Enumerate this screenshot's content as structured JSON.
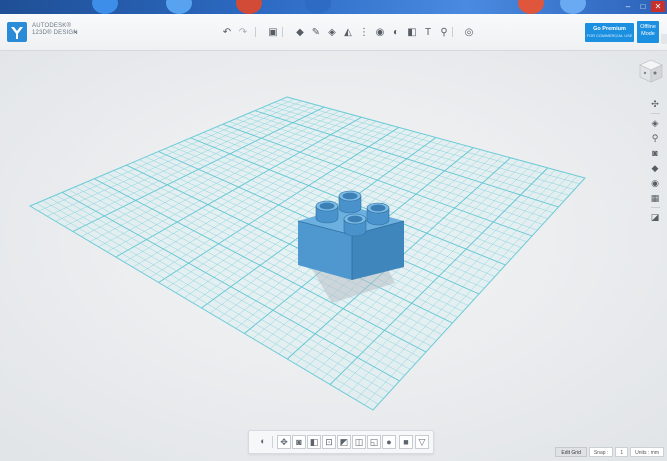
{
  "app": {
    "brand_line1": "AUTODESK®",
    "brand_line2": "123D® DESIGN",
    "menu_icon": "chevron-down-icon"
  },
  "toolbar": {
    "tools": [
      {
        "name": "undo-icon",
        "glyph": "↶"
      },
      {
        "name": "redo-icon",
        "glyph": "↷"
      },
      {
        "name": "new-project-icon",
        "glyph": "▣"
      },
      {
        "name": "primitives-icon",
        "glyph": "◆"
      },
      {
        "name": "sketch-icon",
        "glyph": "✎"
      },
      {
        "name": "construct-icon",
        "glyph": "◈"
      },
      {
        "name": "modify-icon",
        "glyph": "◭"
      },
      {
        "name": "pattern-icon",
        "glyph": "⋮"
      },
      {
        "name": "group-icon",
        "glyph": "◉"
      },
      {
        "name": "combine-icon",
        "glyph": "◐"
      },
      {
        "name": "measure-icon",
        "glyph": "◧"
      },
      {
        "name": "text-icon",
        "glyph": "T"
      },
      {
        "name": "snap-icon",
        "glyph": "⚲"
      },
      {
        "name": "material-icon",
        "glyph": "◎"
      }
    ]
  },
  "premium": {
    "title": "Go Premium",
    "subtitle": "FOR COMMERCIAL USE"
  },
  "offline": {
    "line1": "Offline",
    "line2": "Mode"
  },
  "navbar": {
    "items": [
      {
        "name": "pan-icon",
        "glyph": "✣"
      },
      {
        "name": "orbit-icon",
        "glyph": "◈"
      },
      {
        "name": "zoom-icon",
        "glyph": "⚲"
      },
      {
        "name": "fit-icon",
        "glyph": "◙"
      },
      {
        "name": "perspective-icon",
        "glyph": "◆"
      },
      {
        "name": "visibility-icon",
        "glyph": "◉"
      },
      {
        "name": "grid-icon",
        "glyph": "▦"
      },
      {
        "name": "material-view-icon",
        "glyph": "◪"
      }
    ]
  },
  "bottom_toolbar": {
    "items": [
      {
        "name": "select-icon",
        "glyph": "◐"
      },
      {
        "name": "move-icon",
        "glyph": "✥"
      },
      {
        "name": "rotate-icon",
        "glyph": "◙"
      },
      {
        "name": "scale-icon",
        "glyph": "◧"
      },
      {
        "name": "align-icon",
        "glyph": "⊡"
      },
      {
        "name": "smart-scale-icon",
        "glyph": "◩"
      },
      {
        "name": "ruler-icon",
        "glyph": "◫"
      },
      {
        "name": "mirror-icon",
        "glyph": "◱"
      },
      {
        "name": "material-icon",
        "glyph": "●"
      },
      {
        "name": "solid-icon",
        "glyph": "■"
      },
      {
        "name": "filter-icon",
        "glyph": "▽"
      }
    ]
  },
  "status_bar": {
    "edit_grid": "Edit Grid",
    "snap_label": "Snap :",
    "snap_value": "1",
    "units_label": "Units : mm"
  },
  "colors": {
    "accent": "#1b8fe0",
    "grid": "#7ed3df",
    "part": "#4f97cf"
  }
}
